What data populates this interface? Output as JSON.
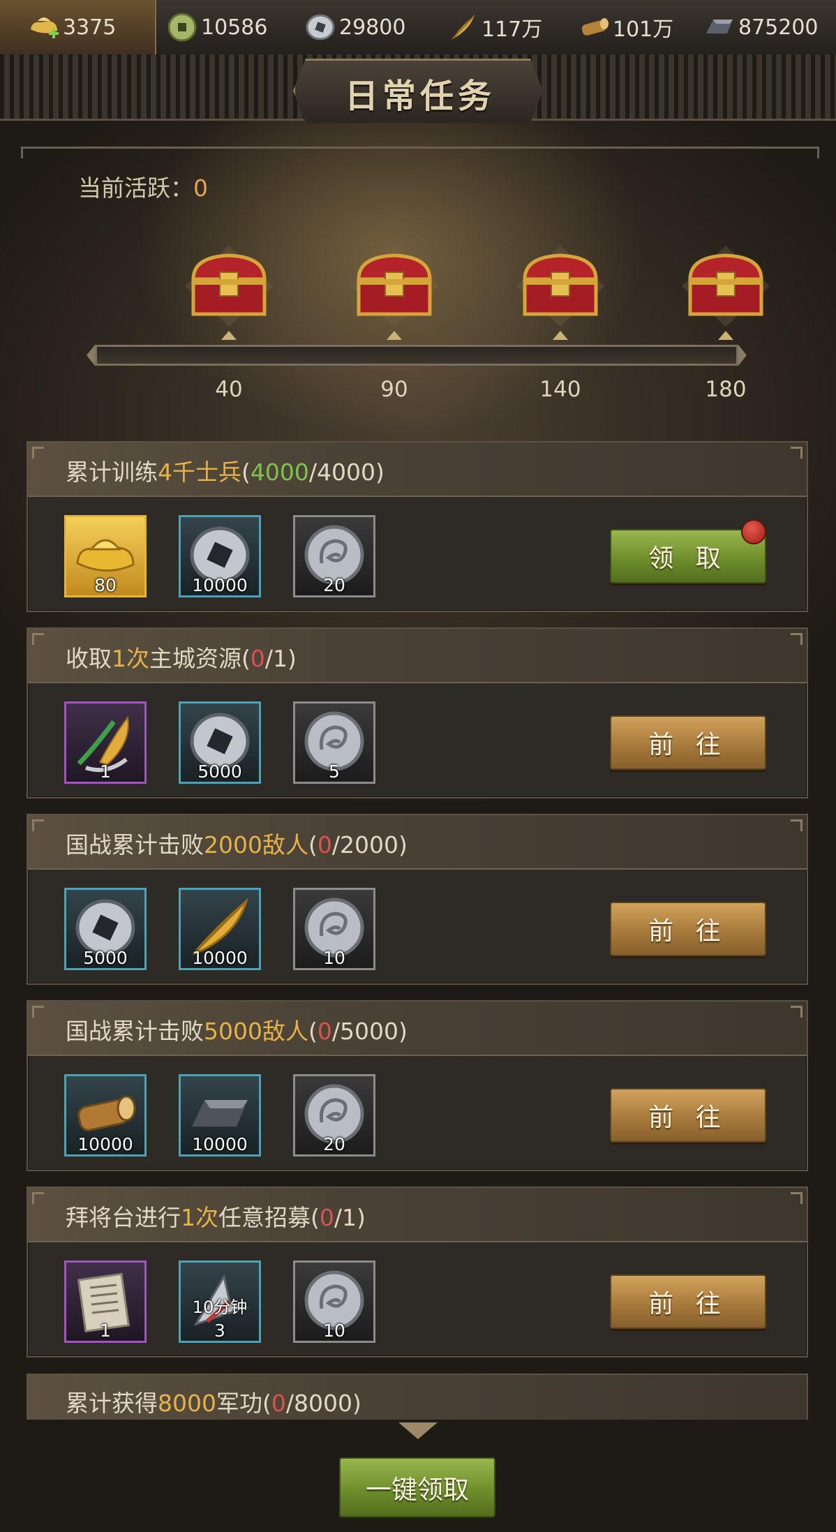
{
  "resources": [
    {
      "icon": "gold-ingot-add-icon",
      "value": "3375"
    },
    {
      "icon": "copper-coin-icon",
      "value": "10586"
    },
    {
      "icon": "silver-coin-icon",
      "value": "29800"
    },
    {
      "icon": "grain-icon",
      "value": "117万"
    },
    {
      "icon": "wood-log-icon",
      "value": "101万"
    },
    {
      "icon": "iron-ingot-icon",
      "value": "875200"
    }
  ],
  "title": "日常任务",
  "activity": {
    "label": "当前活跃：",
    "value": "0",
    "progress": 0
  },
  "milestones": [
    "40",
    "90",
    "140",
    "180"
  ],
  "tasks": [
    {
      "title": {
        "pre": "累计训练",
        "hl": "4千士兵",
        "open": "(",
        "cur": "4000",
        "rest": "/4000)"
      },
      "cur_state": "ok",
      "rewards": [
        {
          "icon": "gold-ingot-icon",
          "frame": "gold",
          "qty": "80"
        },
        {
          "icon": "silver-coin-icon",
          "frame": "blue",
          "qty": "10000"
        },
        {
          "icon": "dragon-coin-icon",
          "frame": "gray",
          "qty": "20"
        }
      ],
      "button": "领 取",
      "button_style": "green",
      "badge": true
    },
    {
      "title": {
        "pre": "收取",
        "hl": "1次",
        "mid": "主城资源",
        "open": "(",
        "cur": "0",
        "rest": "/1)"
      },
      "cur_state": "bad",
      "rewards": [
        {
          "icon": "harvest-tools-icon",
          "frame": "purple",
          "qty": "1"
        },
        {
          "icon": "silver-coin-icon",
          "frame": "blue",
          "qty": "5000"
        },
        {
          "icon": "dragon-coin-icon",
          "frame": "gray",
          "qty": "5"
        }
      ],
      "button": "前 往",
      "button_style": "gold"
    },
    {
      "title": {
        "pre": "国战累计击败",
        "hl": "2000敌人",
        "open": "(",
        "cur": "0",
        "rest": "/2000)"
      },
      "cur_state": "bad",
      "rewards": [
        {
          "icon": "silver-coin-icon",
          "frame": "blue",
          "qty": "5000"
        },
        {
          "icon": "grain-icon",
          "frame": "blue",
          "qty": "10000"
        },
        {
          "icon": "dragon-coin-icon",
          "frame": "gray",
          "qty": "10"
        }
      ],
      "button": "前 往",
      "button_style": "gold"
    },
    {
      "title": {
        "pre": "国战累计击败",
        "hl": "5000敌人",
        "open": "(",
        "cur": "0",
        "rest": "/5000)"
      },
      "cur_state": "bad",
      "rewards": [
        {
          "icon": "wood-log-icon",
          "frame": "blue",
          "qty": "10000"
        },
        {
          "icon": "iron-ingot-icon",
          "frame": "blue",
          "qty": "10000"
        },
        {
          "icon": "dragon-coin-icon",
          "frame": "gray",
          "qty": "20"
        }
      ],
      "button": "前 往",
      "button_style": "gold"
    },
    {
      "title": {
        "pre": "拜将台进行",
        "hl": "1次",
        "mid": "任意招募",
        "open": "(",
        "cur": "0",
        "rest": "/1)"
      },
      "cur_state": "bad",
      "rewards": [
        {
          "icon": "recruit-scroll-icon",
          "frame": "purple",
          "qty": "1"
        },
        {
          "icon": "speedup-arrow-icon",
          "frame": "blue",
          "qty": "3",
          "sub": "10分钟"
        },
        {
          "icon": "dragon-coin-icon",
          "frame": "gray",
          "qty": "10"
        }
      ],
      "button": "前 往",
      "button_style": "gold"
    }
  ],
  "last_task": {
    "pre": "累计获得",
    "hl": "8000",
    "mid": "军功",
    "open": "(",
    "cur": "0",
    "rest": "/8000)"
  },
  "claim_all": "一键领取",
  "colors": {
    "highlight": "#e6b24a",
    "complete": "#7ec64b",
    "incomplete": "#d9534f"
  }
}
